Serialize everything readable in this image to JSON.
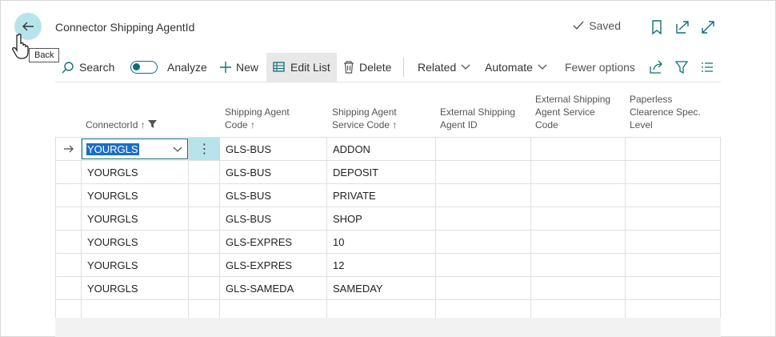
{
  "window": {
    "title": "Connector Shipping AgentId",
    "status": "Saved"
  },
  "tooltip": {
    "back": "Back"
  },
  "actions": {
    "search": "Search",
    "analyze": "Analyze",
    "new": "New",
    "edit_list": "Edit List",
    "delete": "Delete",
    "related": "Related",
    "automate": "Automate",
    "fewer_options": "Fewer options"
  },
  "columns": {
    "connector_id": "ConnectorId",
    "agent_code_l1": "Shipping Agent",
    "agent_code_l2": "Code",
    "service_code_l1": "Shipping Agent",
    "service_code_l2": "Service Code",
    "ext_agent_id_l1": "External Shipping",
    "ext_agent_id_l2": "Agent ID",
    "ext_service_l1": "External Shipping",
    "ext_service_l2": "Agent Service",
    "ext_service_l3": "Code",
    "paperless_l1": "Paperless",
    "paperless_l2": "Clearence Spec.",
    "paperless_l3": "Level"
  },
  "rows": [
    {
      "connector_id": "YOURGLS",
      "agent_code": "GLS-BUS",
      "service_code": "ADDON"
    },
    {
      "connector_id": "YOURGLS",
      "agent_code": "GLS-BUS",
      "service_code": "DEPOSIT"
    },
    {
      "connector_id": "YOURGLS",
      "agent_code": "GLS-BUS",
      "service_code": "PRIVATE"
    },
    {
      "connector_id": "YOURGLS",
      "agent_code": "GLS-BUS",
      "service_code": "SHOP"
    },
    {
      "connector_id": "YOURGLS",
      "agent_code": "GLS-EXPRES",
      "service_code": "10"
    },
    {
      "connector_id": "YOURGLS",
      "agent_code": "GLS-EXPRES",
      "service_code": "12"
    },
    {
      "connector_id": "YOURGLS",
      "agent_code": "GLS-SAMEDA",
      "service_code": "SAMEDAY"
    }
  ],
  "colors": {
    "accent": "#0f6f7a",
    "selection": "#1a6ec7",
    "highlight": "#b7e4ea"
  }
}
